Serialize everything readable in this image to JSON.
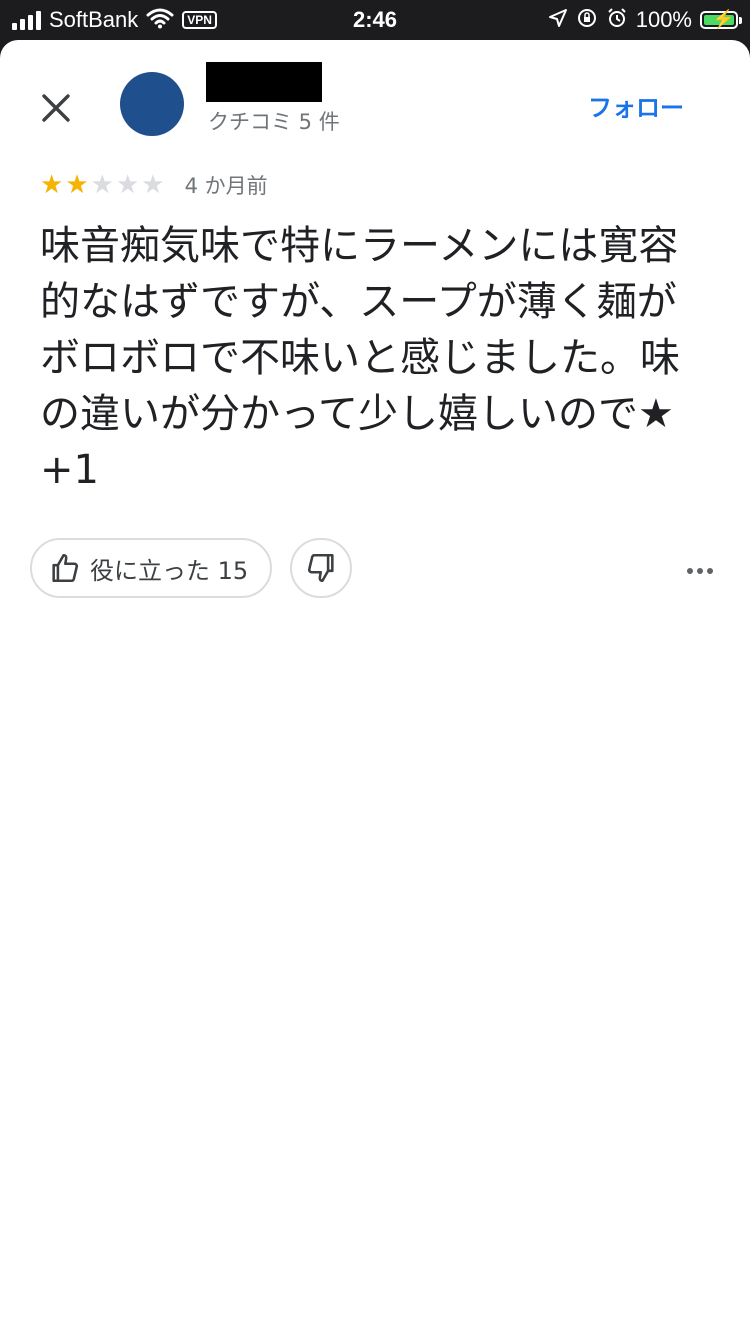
{
  "status_bar": {
    "carrier": "SoftBank",
    "vpn": "VPN",
    "time": "2:46",
    "battery_percent": "100%"
  },
  "reviewer": {
    "review_count": "クチコミ 5 件",
    "follow_label": "フォロー"
  },
  "review": {
    "rating": 2,
    "max_rating": 5,
    "posted": "4 か月前",
    "text": "味音痴気味で特にラーメンには寛容的なはずですが、スープが薄く麺がボロボロで不味いと感じました。味の違いが分かって少し嬉しいので★+1"
  },
  "actions": {
    "helpful_label": "役に立った 15"
  },
  "colors": {
    "accent": "#1a73e8",
    "star_on": "#f4b400",
    "star_off": "#dadce0",
    "avatar": "#1f4f8c"
  },
  "icons": [
    "close-icon",
    "thumbs-up-icon",
    "thumbs-down-icon",
    "more-icon",
    "wifi-icon",
    "location-icon",
    "alarm-icon",
    "battery-icon"
  ]
}
